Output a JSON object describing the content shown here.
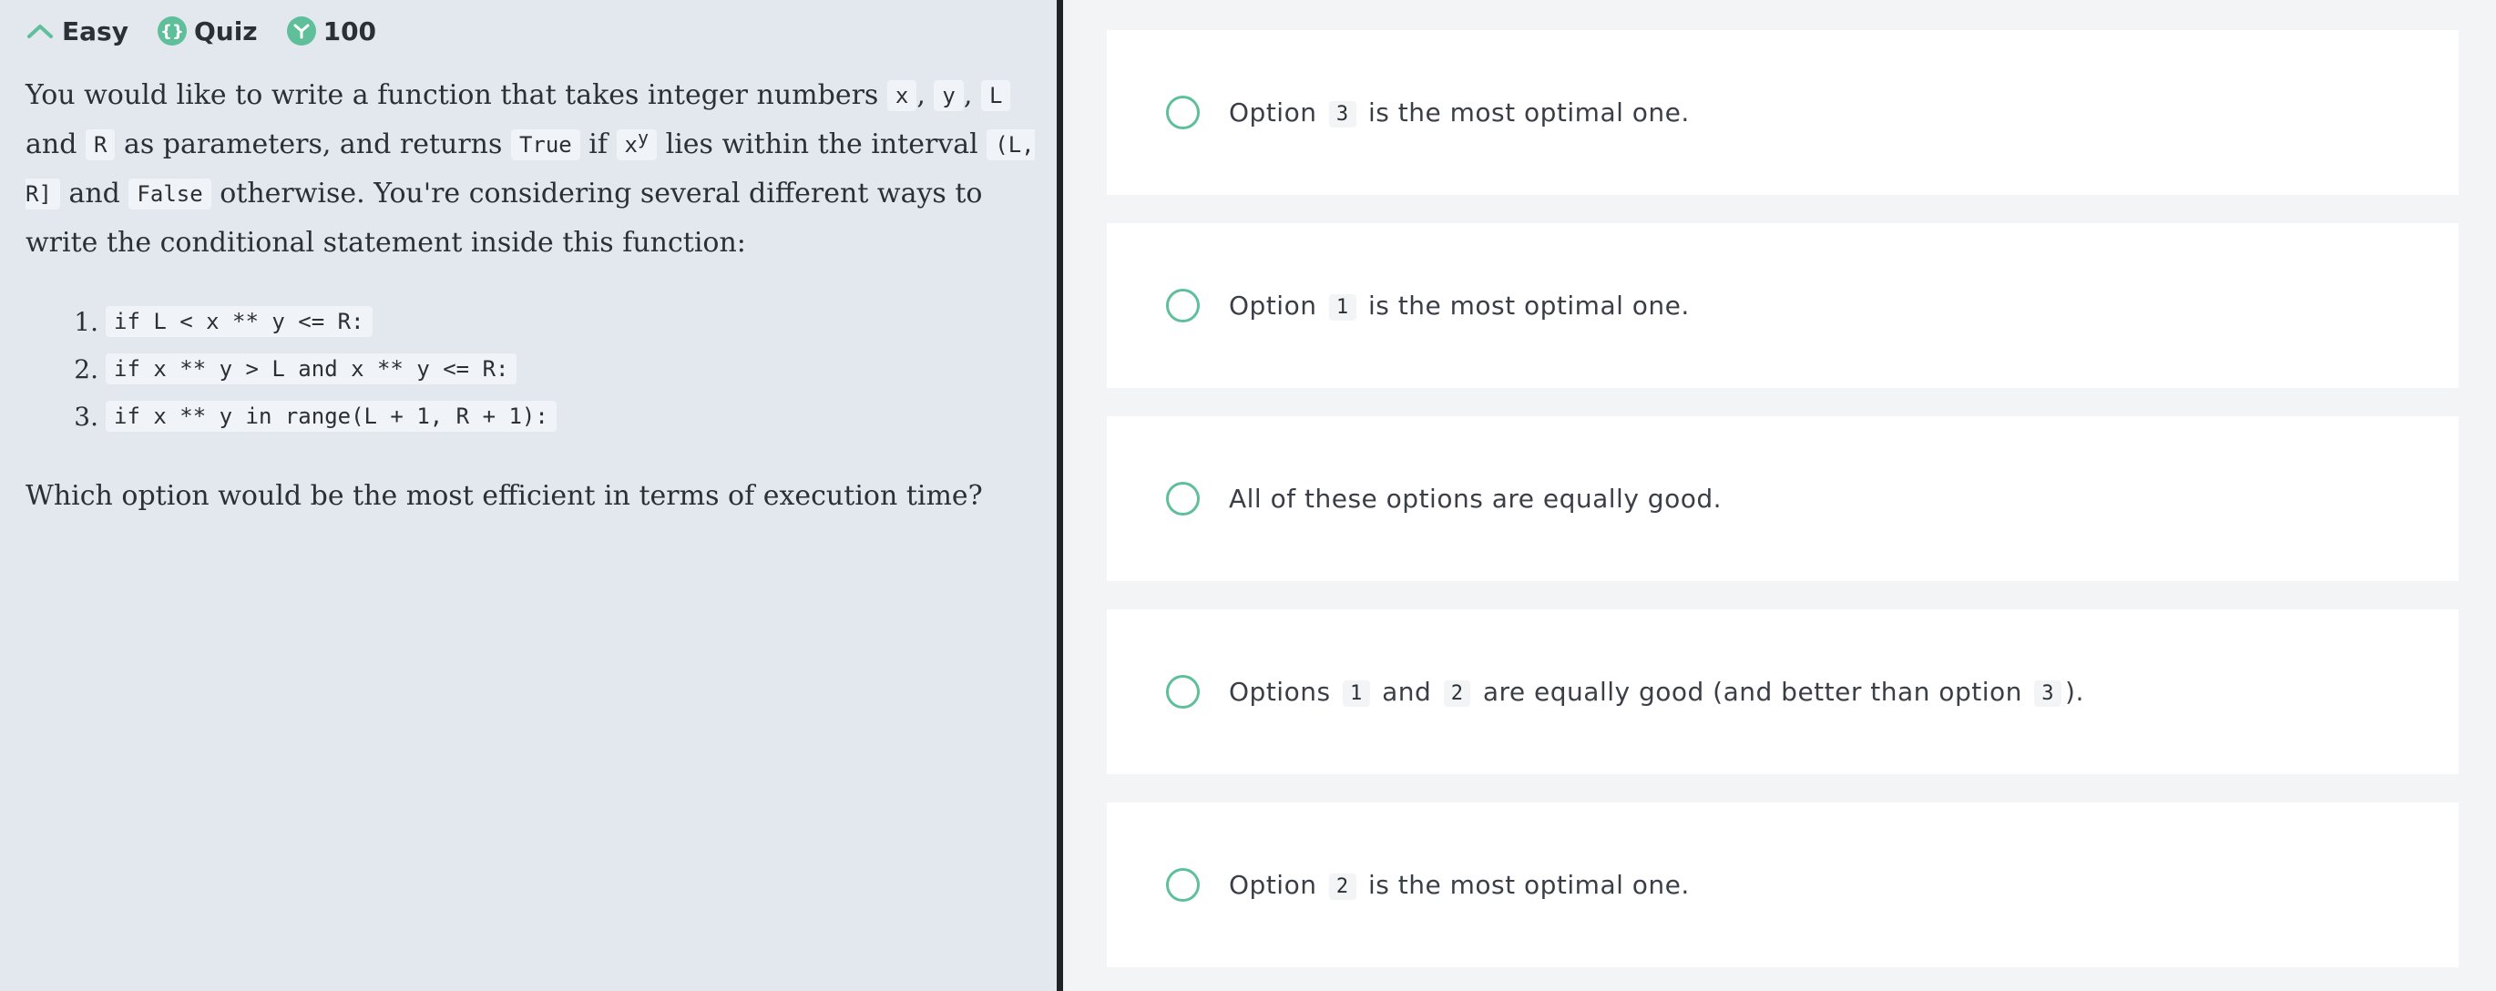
{
  "header": {
    "difficulty": "Easy",
    "type": "Quiz",
    "points": "100",
    "colors": {
      "accent": "#5fbf9b"
    }
  },
  "question": {
    "p1_a": "You would like to write a function that takes integer numbers",
    "var_x": "x",
    "sep1": ",",
    "var_y": "y",
    "sep2": ",",
    "var_L": "L",
    "and1": "and",
    "var_R": "R",
    "p1_b": "as parameters, and returns",
    "kw_true": "True",
    "if_word": "if",
    "pow_base": "x",
    "pow_exp": "y",
    "p1_c": "lies within the interval",
    "interval": "(L, R]",
    "and2": "and",
    "kw_false": "False",
    "p1_d": "otherwise. You're considering several different ways to write the conditional statement inside this function:"
  },
  "code_options": [
    {
      "num": "1.",
      "code": "if L < x ** y <= R:"
    },
    {
      "num": "2.",
      "code": "if x ** y > L and x ** y <= R:"
    },
    {
      "num": "3.",
      "code": "if x ** y in range(L + 1, R + 1):"
    }
  ],
  "closing": "Which option would be the most efficient in terms of execution time?",
  "answers": {
    "a1": {
      "pre": "Option",
      "code": "3",
      "post": "is the most optimal one."
    },
    "a2": {
      "pre": "Option",
      "code": "1",
      "post": "is the most optimal one."
    },
    "a3": {
      "text": "All of these options are equally good."
    },
    "a4": {
      "pre": "Options",
      "code1": "1",
      "mid": "and",
      "code2": "2",
      "post": "are equally good (and better than option",
      "code3": "3",
      "end": ")."
    },
    "a5": {
      "pre": "Option",
      "code": "2",
      "post": "is the most optimal one."
    }
  }
}
